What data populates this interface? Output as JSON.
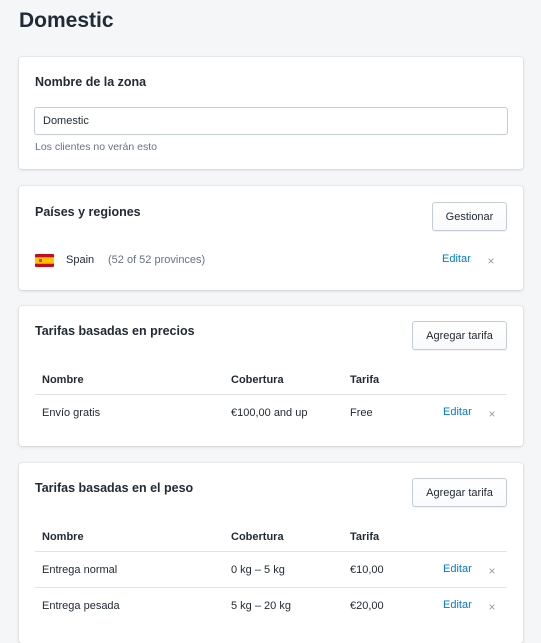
{
  "page": {
    "title": "Domestic"
  },
  "zone_name": {
    "title": "Nombre de la zona",
    "value": "Domestic",
    "help": "Los clientes no verán esto"
  },
  "countries": {
    "title": "Países y regiones",
    "manage_label": "Gestionar",
    "items": [
      {
        "name": "Spain",
        "detail": "(52 of 52 provinces)",
        "edit_label": "Editar",
        "remove_label": "×",
        "flag": "spain-flag"
      }
    ]
  },
  "price_rates": {
    "title": "Tarifas basadas en precios",
    "add_label": "Agregar tarifa",
    "headers": {
      "name": "Nombre",
      "coverage": "Cobertura",
      "rate": "Tarifa"
    },
    "rows": [
      {
        "name": "Envío gratis",
        "coverage": "€100,00 and up",
        "rate": "Free",
        "edit_label": "Editar",
        "remove_label": "×"
      }
    ]
  },
  "weight_rates": {
    "title": "Tarifas basadas en el peso",
    "add_label": "Agregar tarifa",
    "headers": {
      "name": "Nombre",
      "coverage": "Cobertura",
      "rate": "Tarifa"
    },
    "rows": [
      {
        "name": "Entrega normal",
        "coverage": "0 kg – 5 kg",
        "rate": "€10,00",
        "edit_label": "Editar",
        "remove_label": "×"
      },
      {
        "name": "Entrega pesada",
        "coverage": "5 kg – 20 kg",
        "rate": "€20,00",
        "edit_label": "Editar",
        "remove_label": "×"
      }
    ]
  },
  "colors": {
    "background": "#f4f6f8",
    "card": "#ffffff",
    "link": "#007ace",
    "text": "#212b36",
    "muted": "#637381",
    "divider": "#dfe3e8"
  }
}
